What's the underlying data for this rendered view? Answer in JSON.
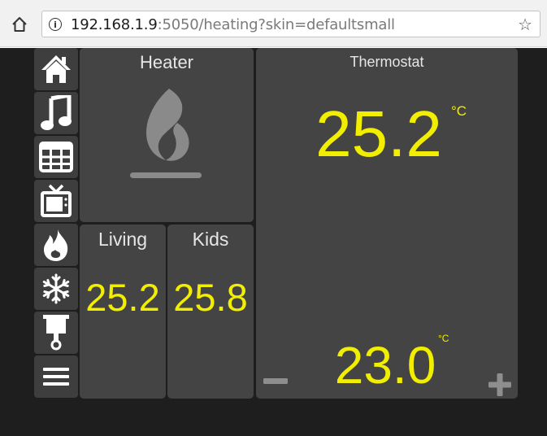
{
  "browser": {
    "url_host": "192.168.1.9",
    "url_rest": ":5050/heating?skin=defaultsmall",
    "icons": {
      "home": "home-icon",
      "info": "info-icon",
      "bookmark": "star-icon"
    }
  },
  "sidebar": {
    "items": [
      {
        "name": "home",
        "icon": "home-icon"
      },
      {
        "name": "music",
        "icon": "music-note-icon"
      },
      {
        "name": "grid",
        "icon": "grid-icon"
      },
      {
        "name": "tv",
        "icon": "tv-icon"
      },
      {
        "name": "heating",
        "icon": "flame-icon"
      },
      {
        "name": "cooling",
        "icon": "snowflake-icon"
      },
      {
        "name": "lamp",
        "icon": "ceiling-lamp-icon"
      },
      {
        "name": "menu",
        "icon": "hamburger-menu-icon"
      }
    ]
  },
  "heater": {
    "title": "Heater",
    "icon": "flame-icon"
  },
  "living": {
    "title": "Living",
    "value": "25.2"
  },
  "kids": {
    "title": "Kids",
    "value": "25.8"
  },
  "thermostat": {
    "title": "Thermostat",
    "current": "25.2",
    "current_unit": "°C",
    "setpoint": "23.0",
    "setpoint_unit": "°C",
    "decrease_icon": "minus-icon",
    "increase_icon": "plus-icon"
  },
  "colors": {
    "value_yellow": "#f2ee00",
    "tile_bg": "#444444",
    "dashboard_bg": "#1e1e1e",
    "icon_white": "#ffffff",
    "heater_icon_grey": "#8a8a8a"
  }
}
